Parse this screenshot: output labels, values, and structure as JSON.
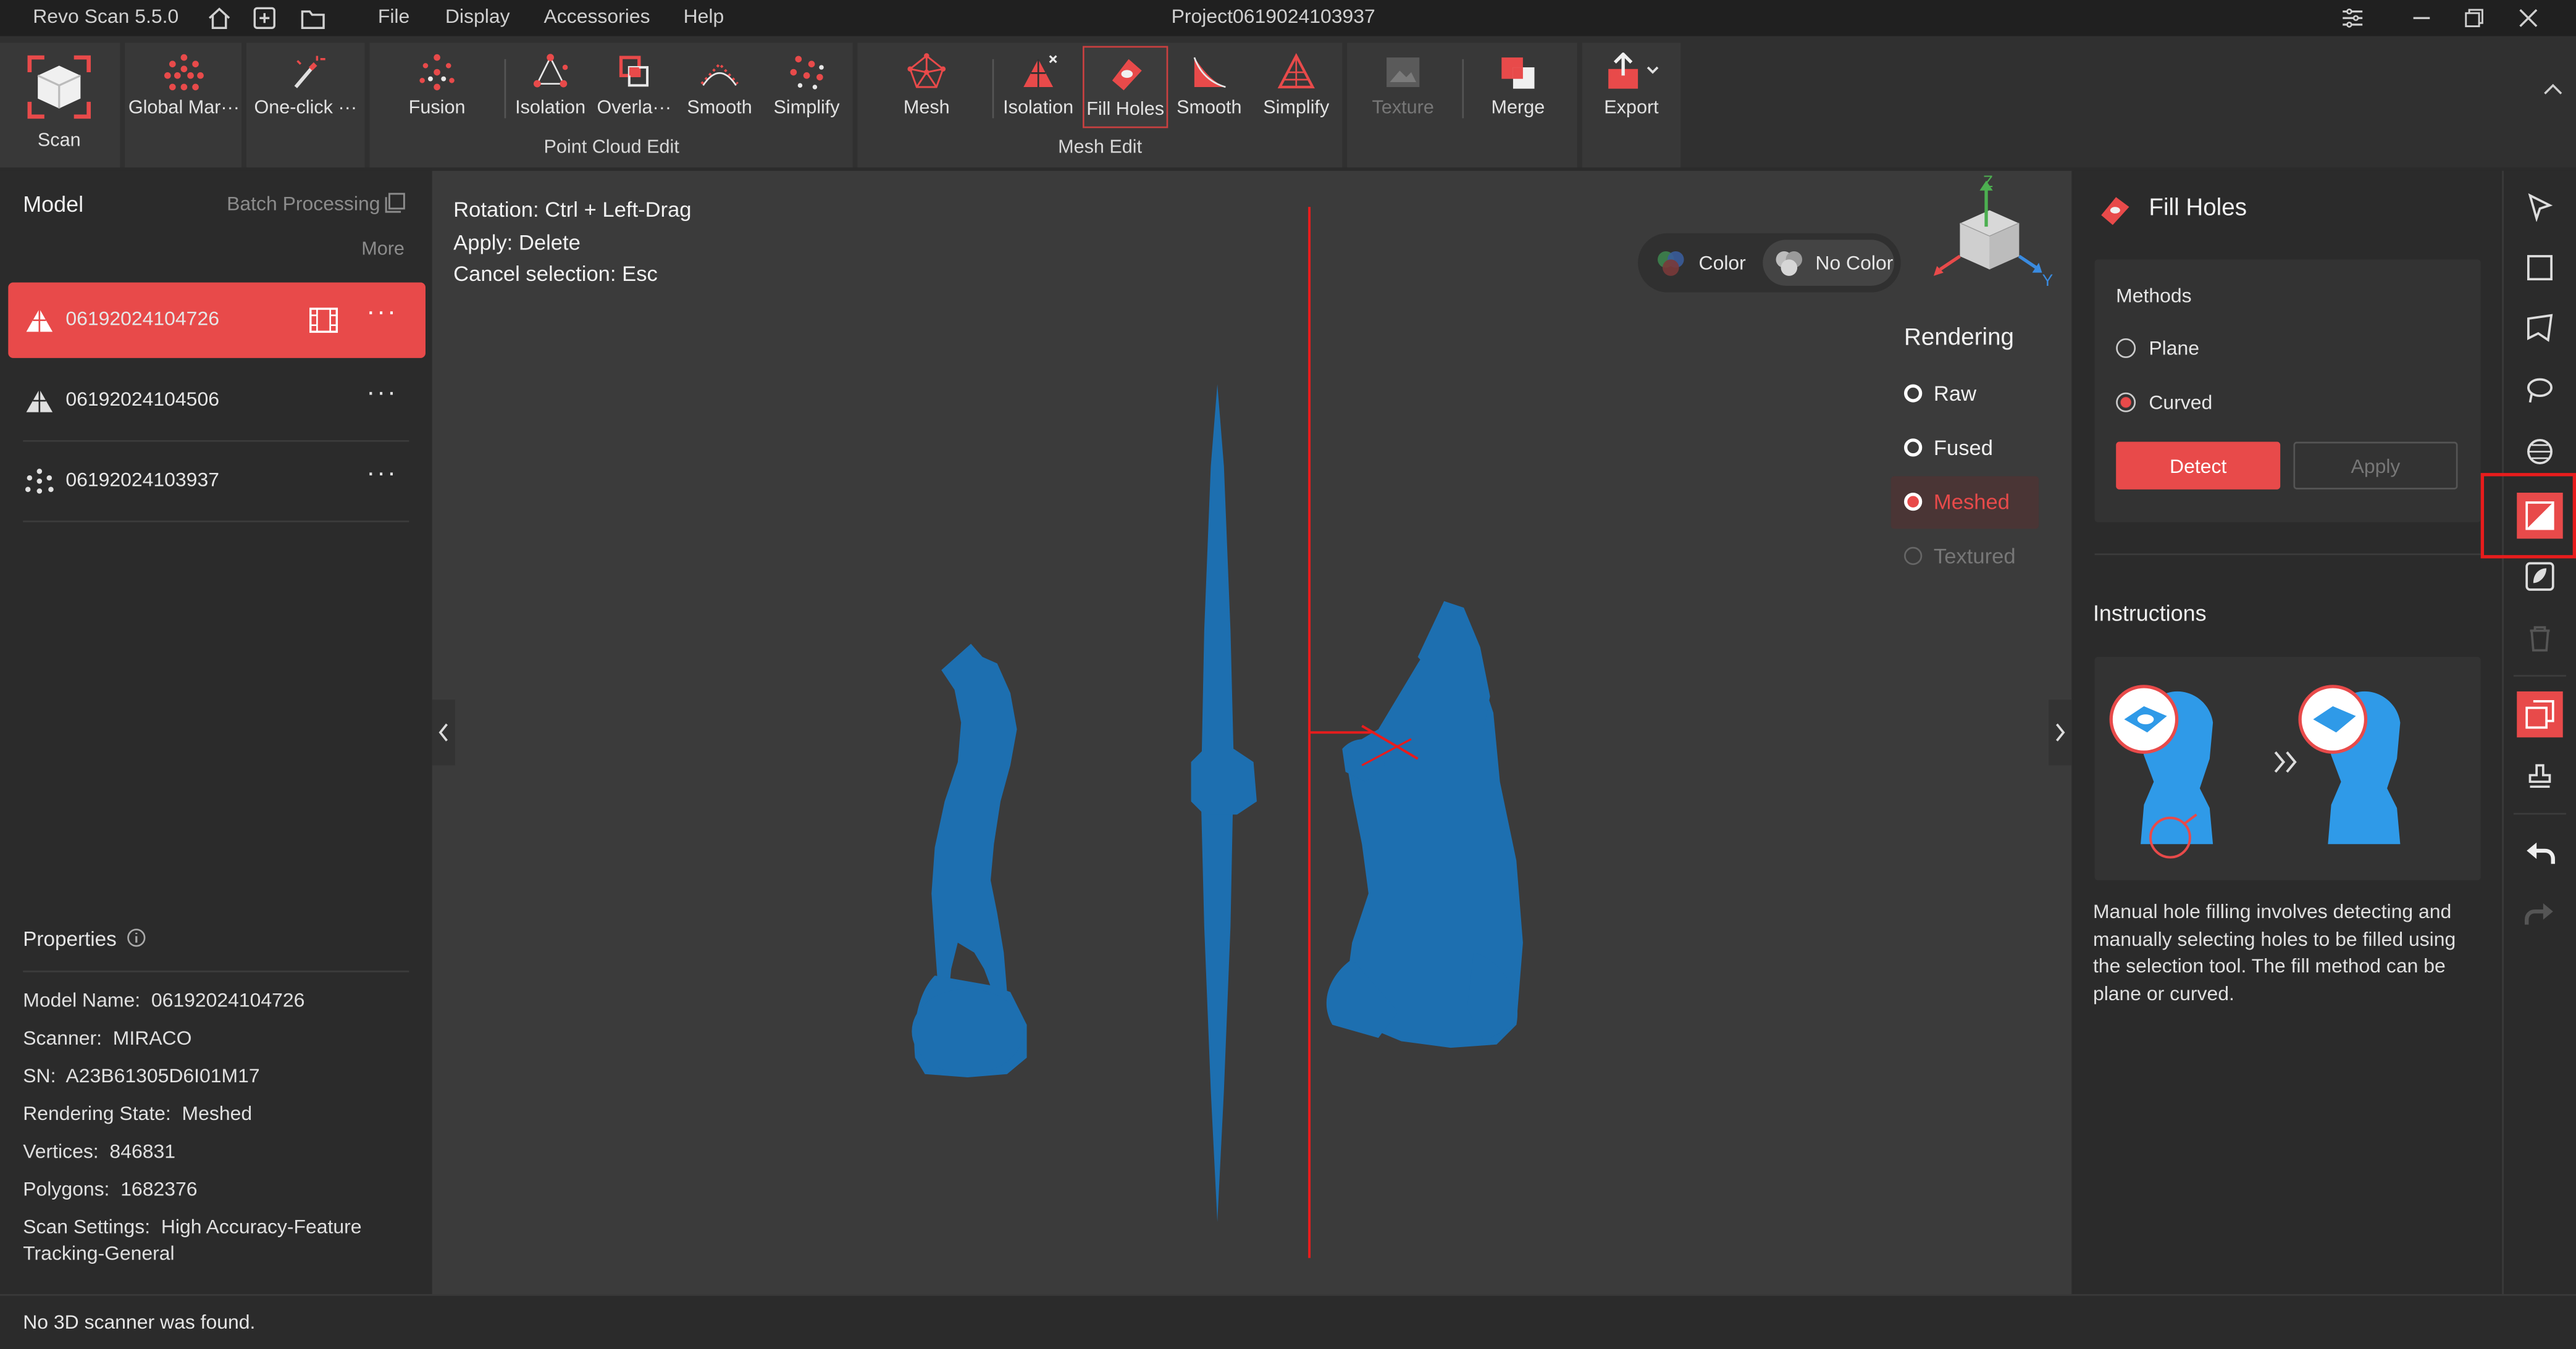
{
  "app": {
    "name": "Revo Scan 5.5.0",
    "project": "Project0619024103937"
  },
  "menu": [
    "File",
    "Display",
    "Accessories",
    "Help"
  ],
  "toolbar": {
    "scan": "Scan",
    "global_markers": "Global Mar···",
    "one_click": "One-click ···",
    "pc_fusion": "Fusion",
    "pc_isolation": "Isolation",
    "pc_overlap": "Overla···",
    "pc_smooth": "Smooth",
    "pc_simplify": "Simplify",
    "point_cloud_edit": "Point Cloud Edit",
    "mesh": "Mesh",
    "mesh_isolation": "Isolation",
    "fill_holes": "Fill Holes",
    "mesh_smooth": "Smooth",
    "mesh_simplify": "Simplify",
    "mesh_edit": "Mesh Edit",
    "texture": "Texture",
    "merge": "Merge",
    "export": "Export"
  },
  "left": {
    "title": "Model",
    "batch": "Batch Processing",
    "more": "More",
    "models": [
      {
        "name": "06192024104726"
      },
      {
        "name": "06192024104506"
      },
      {
        "name": "06192024103937"
      }
    ],
    "properties_title": "Properties",
    "props": [
      {
        "label": "Model Name:",
        "value": "06192024104726"
      },
      {
        "label": "Scanner:",
        "value": "MIRACO"
      },
      {
        "label": "SN:",
        "value": "A23B61305D6I01M17"
      },
      {
        "label": "Rendering State:",
        "value": "Meshed"
      },
      {
        "label": "Vertices:",
        "value": "846831"
      },
      {
        "label": "Polygons:",
        "value": "1682376"
      },
      {
        "label": "Scan Settings:",
        "value": "High Accuracy-Feature",
        "value2": "Tracking-General"
      }
    ]
  },
  "viewport": {
    "hints": [
      "Rotation: Ctrl + Left-Drag",
      "Apply: Delete",
      "Cancel selection: Esc"
    ],
    "color": "Color",
    "no_color": "No Color",
    "axes": {
      "z": "Z",
      "y": "Y"
    },
    "rendering_title": "Rendering",
    "rendering": [
      {
        "label": "Raw"
      },
      {
        "label": "Fused"
      },
      {
        "label": "Meshed"
      },
      {
        "label": "Textured"
      }
    ]
  },
  "right": {
    "title": "Fill Holes",
    "methods": "Methods",
    "plane": "Plane",
    "curved": "Curved",
    "detect": "Detect",
    "apply": "Apply",
    "instructions": "Instructions",
    "desc": [
      "Manual hole filling involves detecting and",
      "manually selecting holes to be filled using",
      "the selection tool. The fill method can be",
      "plane or curved."
    ]
  },
  "status": "No 3D scanner was found.",
  "colors": {
    "accent": "#e84a4a",
    "model_blue": "#1d6fb0"
  }
}
